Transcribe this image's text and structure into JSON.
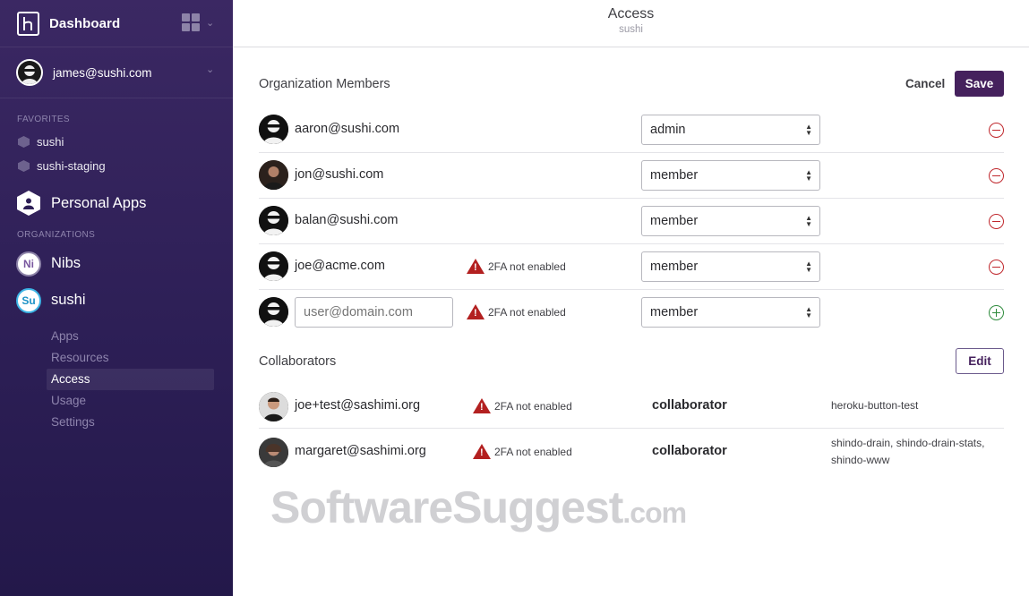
{
  "sidebar": {
    "title": "Dashboard",
    "account": "james@sushi.com",
    "favorites_label": "FAVORITES",
    "favorites": [
      "sushi",
      "sushi-staging"
    ],
    "personal_apps": "Personal Apps",
    "organizations_label": "ORGANIZATIONS",
    "orgs": [
      {
        "badge": "Ni",
        "name": "Nibs"
      },
      {
        "badge": "Su",
        "name": "sushi"
      }
    ],
    "subnav": [
      "Apps",
      "Resources",
      "Access",
      "Usage",
      "Settings"
    ],
    "active_subnav": "Access"
  },
  "header": {
    "title": "Access",
    "subtitle": "sushi"
  },
  "members": {
    "title": "Organization Members",
    "cancel": "Cancel",
    "save": "Save",
    "rows": [
      {
        "email": "aaron@sushi.com",
        "warning": "",
        "role": "admin"
      },
      {
        "email": "jon@sushi.com",
        "warning": "",
        "role": "member"
      },
      {
        "email": "balan@sushi.com",
        "warning": "",
        "role": "member"
      },
      {
        "email": "joe@acme.com",
        "warning": "2FA not enabled",
        "role": "member"
      }
    ],
    "new_row": {
      "placeholder": "user@domain.com",
      "warning": "2FA not enabled",
      "role": "member"
    }
  },
  "collaborators": {
    "title": "Collaborators",
    "edit": "Edit",
    "rows": [
      {
        "email": "joe+test@sashimi.org",
        "warning": "2FA not enabled",
        "role": "collaborator",
        "apps": "heroku-button-test"
      },
      {
        "email": "margaret@sashimi.org",
        "warning": "2FA not enabled",
        "role": "collaborator",
        "apps": "shindo-drain, shindo-drain-stats, shindo-www"
      }
    ]
  },
  "watermark": {
    "main": "SoftwareSuggest",
    "suffix": ".com"
  },
  "colors": {
    "sidebar": "#2d1f56",
    "save": "#45215d",
    "remove": "#c0282d",
    "add": "#2e8b3c",
    "warning": "#b32020"
  }
}
